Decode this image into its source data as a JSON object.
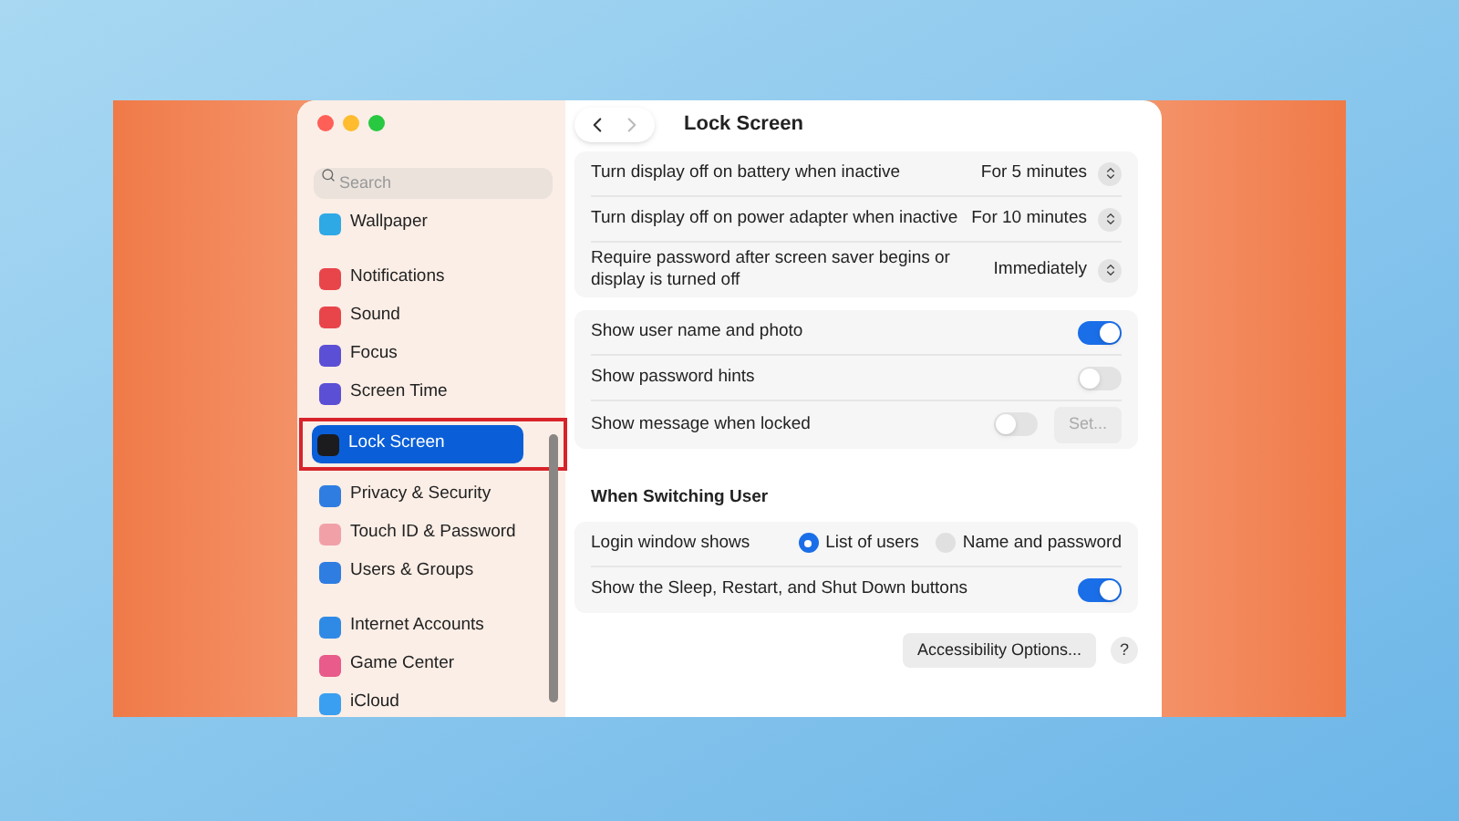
{
  "sidebar": {
    "search": {
      "placeholder": "Search"
    },
    "groups": [
      [
        {
          "label": "Wallpaper",
          "color": "#2fa8e6",
          "selected": false
        }
      ],
      [
        {
          "label": "Notifications",
          "color": "#e8454b",
          "selected": false
        },
        {
          "label": "Sound",
          "color": "#e8454b",
          "selected": false
        },
        {
          "label": "Focus",
          "color": "#5b4fd6",
          "selected": false
        },
        {
          "label": "Screen Time",
          "color": "#5b4fd6",
          "selected": false
        },
        {
          "label": "Lock Screen",
          "color": "#1c1c1e",
          "selected": true
        },
        {
          "label": "Privacy & Security",
          "color": "#2f7de1",
          "selected": false
        },
        {
          "label": "Touch ID & Password",
          "color": "#f2a0a8",
          "selected": false
        },
        {
          "label": "Users & Groups",
          "color": "#2f7de1",
          "selected": false
        }
      ],
      [
        {
          "label": "Internet Accounts",
          "color": "#2f8ae6",
          "selected": false
        },
        {
          "label": "Game Center",
          "color": "#e85b8a",
          "selected": false
        },
        {
          "label": "iCloud",
          "color": "#3a9ff0",
          "selected": false
        }
      ]
    ]
  },
  "content": {
    "title": "Lock Screen",
    "groups": [
      [
        {
          "kind": "select",
          "label": "Turn display off on battery when inactive",
          "value": "For 5 minutes"
        },
        {
          "kind": "select",
          "label": "Turn display off on power adapter when inactive",
          "value": "For 10 minutes"
        },
        {
          "kind": "select",
          "label": "Require password after screen saver begins or display is turned off",
          "value": "Immediately"
        }
      ],
      [
        {
          "kind": "toggle",
          "label": "Show user name and photo",
          "on": true
        },
        {
          "kind": "toggle",
          "label": "Show password hints",
          "on": false
        },
        {
          "kind": "toggle_button",
          "label": "Show message when locked",
          "on": false,
          "button": {
            "label": "Set...",
            "disabled": true
          }
        }
      ]
    ],
    "section": {
      "title": "When Switching User",
      "rows": [
        {
          "kind": "radio",
          "label": "Login window shows",
          "options": [
            {
              "label": "List of users",
              "selected": true
            },
            {
              "label": "Name and password",
              "selected": false
            }
          ]
        },
        {
          "kind": "toggle",
          "label": "Show the Sleep, Restart, and Shut Down buttons",
          "on": true
        }
      ]
    },
    "accessibility_button": "Accessibility Options...",
    "help_button": "?"
  }
}
